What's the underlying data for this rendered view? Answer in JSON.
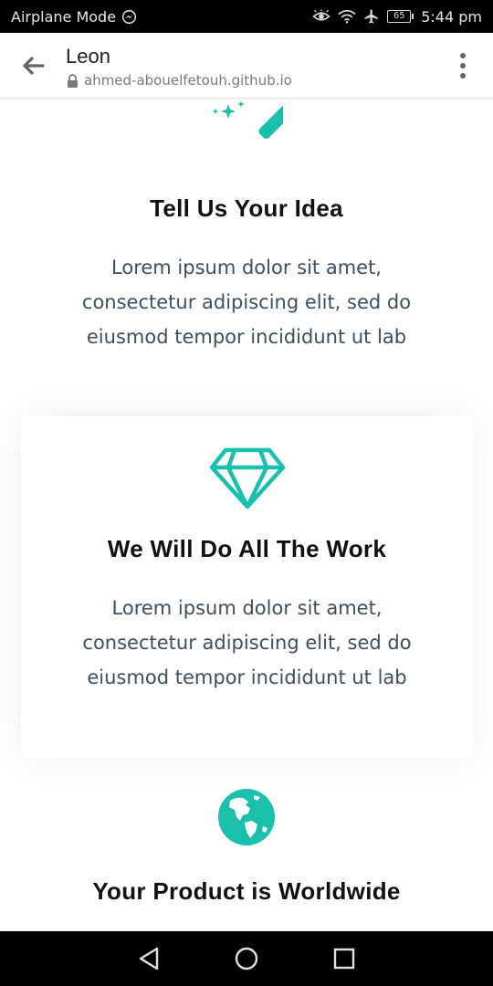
{
  "status_bar": {
    "left_text": "Airplane Mode",
    "battery_level": "65",
    "time": "5:44 pm",
    "icons": [
      "messenger-icon",
      "eye-icon",
      "wifi-icon",
      "airplane-icon",
      "battery-icon"
    ]
  },
  "browser": {
    "title": "Leon",
    "url": "ahmed-abouelfetouh.github.io"
  },
  "features": [
    {
      "icon": "magic-wand-icon",
      "title": "Tell Us Your Idea",
      "text": "Lorem ipsum dolor sit amet, consectetur adipiscing elit, sed do eiusmod tempor incididunt ut lab"
    },
    {
      "icon": "diamond-icon",
      "title": "We Will Do All The Work",
      "text": "Lorem ipsum dolor sit amet, consectetur adipiscing elit, sed do eiusmod tempor incididunt ut lab"
    },
    {
      "icon": "globe-icon",
      "title": "Your Product is Worldwide",
      "text": ""
    }
  ],
  "colors": {
    "accent": "#1bbfad",
    "title": "#111111",
    "body_text": "#3d4f5c"
  }
}
